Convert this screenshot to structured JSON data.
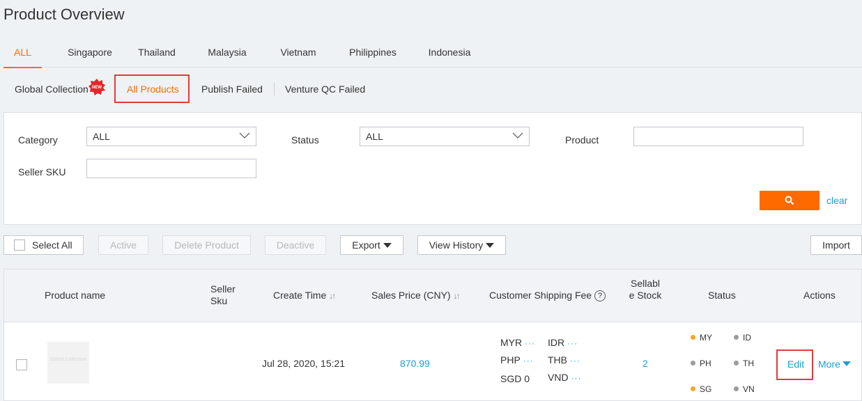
{
  "page": {
    "title": "Product Overview"
  },
  "country_tabs": [
    {
      "label": "ALL",
      "active": true
    },
    {
      "label": "Singapore"
    },
    {
      "label": "Thailand"
    },
    {
      "label": "Malaysia"
    },
    {
      "label": "Vietnam"
    },
    {
      "label": "Philippines"
    },
    {
      "label": "Indonesia"
    }
  ],
  "sub_tabs": {
    "global_collection": "Global Collection",
    "new_badge": "NEW",
    "all_products": "All Products",
    "publish_failed": "Publish Failed",
    "venture_qc_failed": "Venture QC Failed"
  },
  "filters": {
    "category_label": "Category",
    "category_value": "ALL",
    "status_label": "Status",
    "status_value": "ALL",
    "product_label": "Product",
    "product_value": "",
    "seller_sku_label": "Seller SKU",
    "seller_sku_value": "",
    "clear_label": "clear"
  },
  "toolbar": {
    "select_all": "Select All",
    "active": "Active",
    "delete_product": "Delete Product",
    "deactive": "Deactive",
    "export": "Export",
    "view_history": "View History",
    "import": "Import"
  },
  "table": {
    "headers": {
      "product_name": "Product name",
      "seller_sku": "Seller Sku",
      "create_time": "Create Time",
      "sales_price": "Sales Price (CNY)",
      "shipping_fee": "Customer Shipping Fee",
      "sellable_stock": "Sellable Stock",
      "status": "Status",
      "actions": "Actions"
    },
    "rows": [
      {
        "thumbnail_text": "Global Collection",
        "create_time": "Jul 28, 2020, 15:21",
        "sales_price": "870.99",
        "shipping": {
          "myr": "MYR",
          "idr": "IDR",
          "php": "PHP",
          "thb": "THB",
          "sgd": "SGD",
          "sgd_value": "0",
          "vnd": "VND",
          "more": "···"
        },
        "stock": "2",
        "status": {
          "my": "MY",
          "id": "ID",
          "ph": "PH",
          "th": "TH",
          "sg": "SG",
          "vn": "VN"
        },
        "edit": "Edit",
        "more": "More"
      }
    ]
  },
  "colors": {
    "accent": "#ff6a00",
    "link": "#1a9fd3",
    "highlight": "#e4393c",
    "status_orange": "#f5a623",
    "status_grey": "#9b9b9b"
  }
}
